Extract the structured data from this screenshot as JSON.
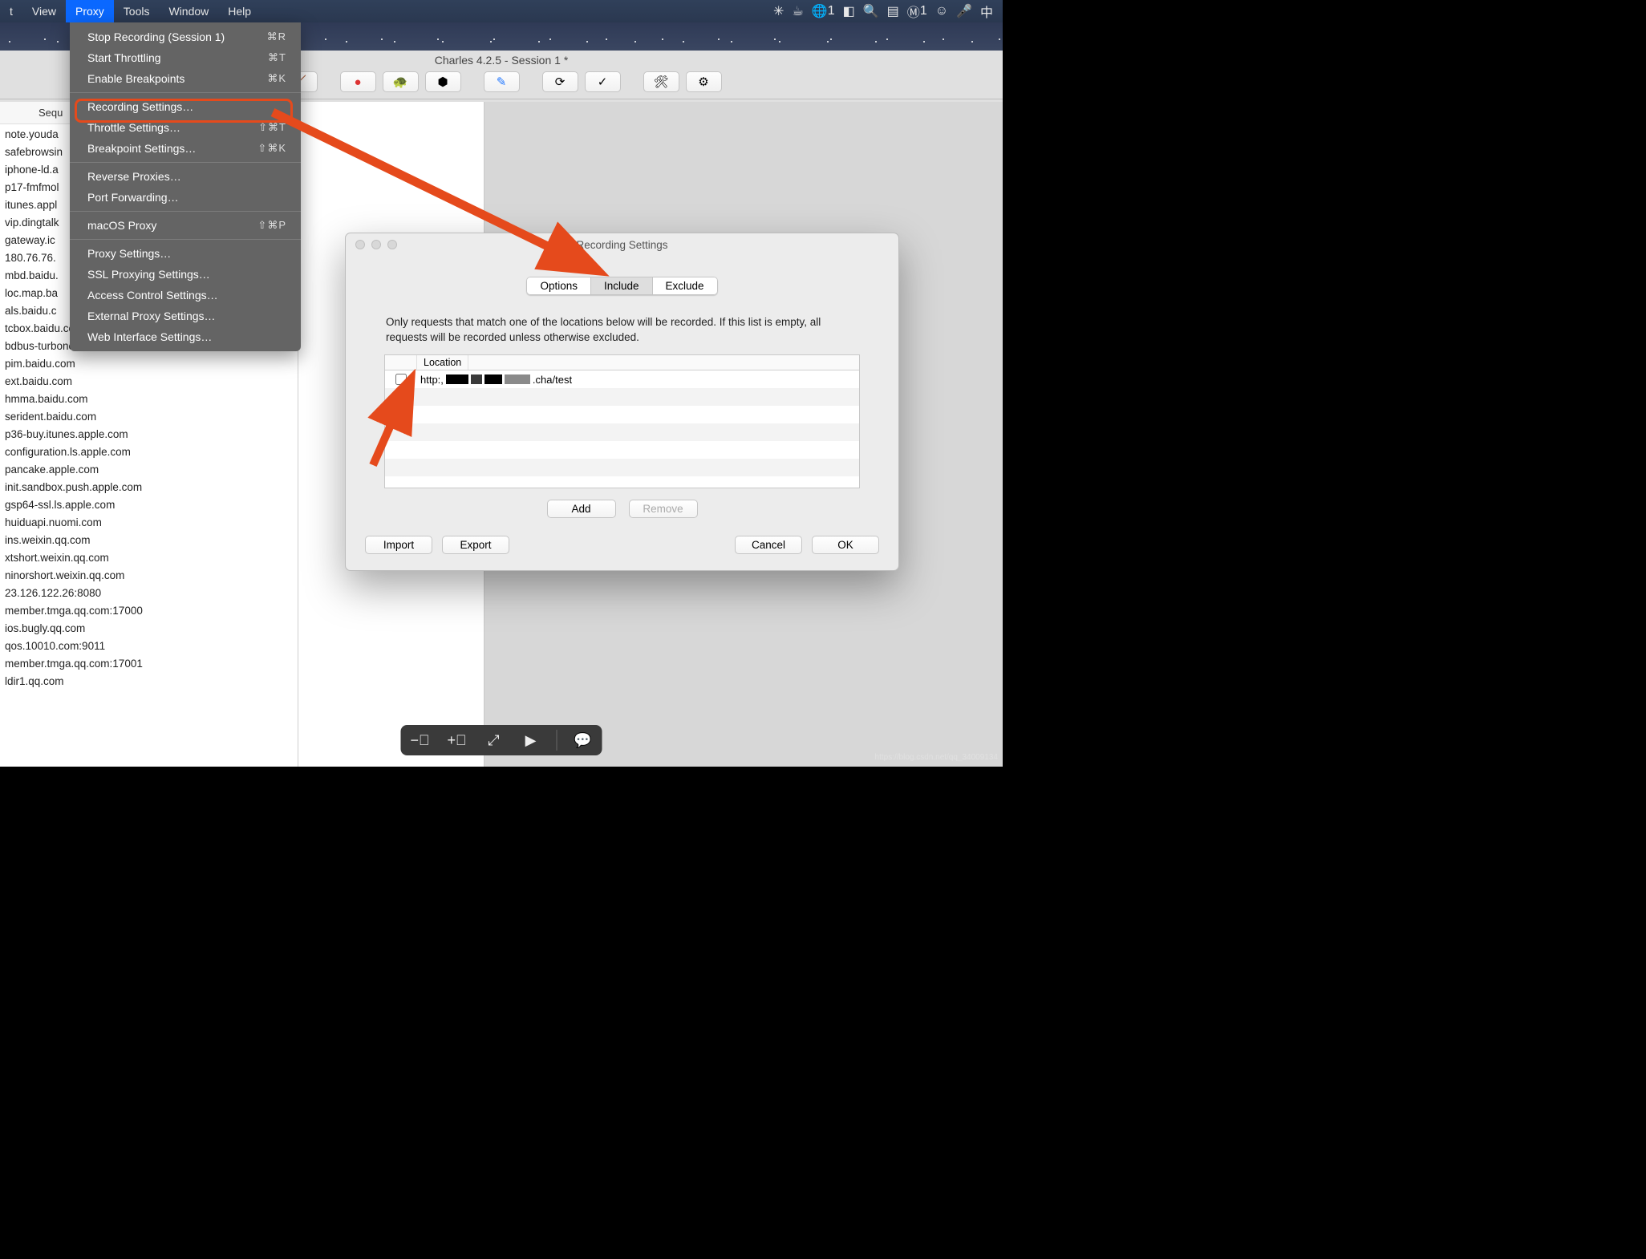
{
  "menubar": {
    "items": [
      "t",
      "View",
      "Proxy",
      "Tools",
      "Window",
      "Help"
    ],
    "selected_index": 2,
    "right_badge_1": "1",
    "right_badge_2": "1",
    "ime": "中"
  },
  "window": {
    "title": "Charles 4.2.5 - Session 1 *"
  },
  "sidebar": {
    "header": "Sequ",
    "items": [
      "note.youda",
      "safebrowsin",
      "iphone-ld.a",
      "p17-fmfmol",
      "itunes.appl",
      "vip.dingtalk",
      "gateway.ic",
      "180.76.76.",
      "mbd.baidu.",
      "loc.map.ba",
      "als.baidu.c",
      "tcbox.baidu.com",
      "bdbus-turbonet.baidu.com",
      "pim.baidu.com",
      "ext.baidu.com",
      "hmma.baidu.com",
      "serident.baidu.com",
      "p36-buy.itunes.apple.com",
      "configuration.ls.apple.com",
      "pancake.apple.com",
      "init.sandbox.push.apple.com",
      "gsp64-ssl.ls.apple.com",
      "huiduapi.nuomi.com",
      "ins.weixin.qq.com",
      "xtshort.weixin.qq.com",
      "ninorshort.weixin.qq.com",
      "23.126.122.26:8080",
      "member.tmga.qq.com:17000",
      "ios.bugly.qq.com",
      "qos.10010.com:9011",
      "member.tmga.qq.com:17001",
      "ldir1.qq.com"
    ]
  },
  "menu": {
    "groups": [
      [
        {
          "label": "Stop Recording (Session 1)",
          "shortcut": "⌘R"
        },
        {
          "label": "Start Throttling",
          "shortcut": "⌘T"
        },
        {
          "label": "Enable Breakpoints",
          "shortcut": "⌘K"
        }
      ],
      [
        {
          "label": "Recording Settings…",
          "shortcut": ""
        },
        {
          "label": "Throttle Settings…",
          "shortcut": "⇧⌘T"
        },
        {
          "label": "Breakpoint Settings…",
          "shortcut": "⇧⌘K"
        }
      ],
      [
        {
          "label": "Reverse Proxies…",
          "shortcut": ""
        },
        {
          "label": "Port Forwarding…",
          "shortcut": ""
        }
      ],
      [
        {
          "label": "macOS Proxy",
          "shortcut": "⇧⌘P"
        }
      ],
      [
        {
          "label": "Proxy Settings…",
          "shortcut": ""
        },
        {
          "label": "SSL Proxying Settings…",
          "shortcut": ""
        },
        {
          "label": "Access Control Settings…",
          "shortcut": ""
        },
        {
          "label": "External Proxy Settings…",
          "shortcut": ""
        },
        {
          "label": "Web Interface Settings…",
          "shortcut": ""
        }
      ]
    ]
  },
  "dialog": {
    "title": "Recording Settings",
    "tabs": [
      "Options",
      "Include",
      "Exclude"
    ],
    "active_tab": 1,
    "description": "Only requests that match one of the locations below will be recorded. If this list is empty, all requests will be recorded unless otherwise excluded.",
    "columns": {
      "checkbox": "",
      "location": "Location"
    },
    "rows": [
      {
        "checked": false,
        "prefix": "http:,",
        "suffix": ".cha/test"
      }
    ],
    "buttons": {
      "add": "Add",
      "remove": "Remove",
      "import": "Import",
      "export": "Export",
      "cancel": "Cancel",
      "ok": "OK"
    }
  },
  "watermark": "https://blog.csdn.net/qq_34009134"
}
